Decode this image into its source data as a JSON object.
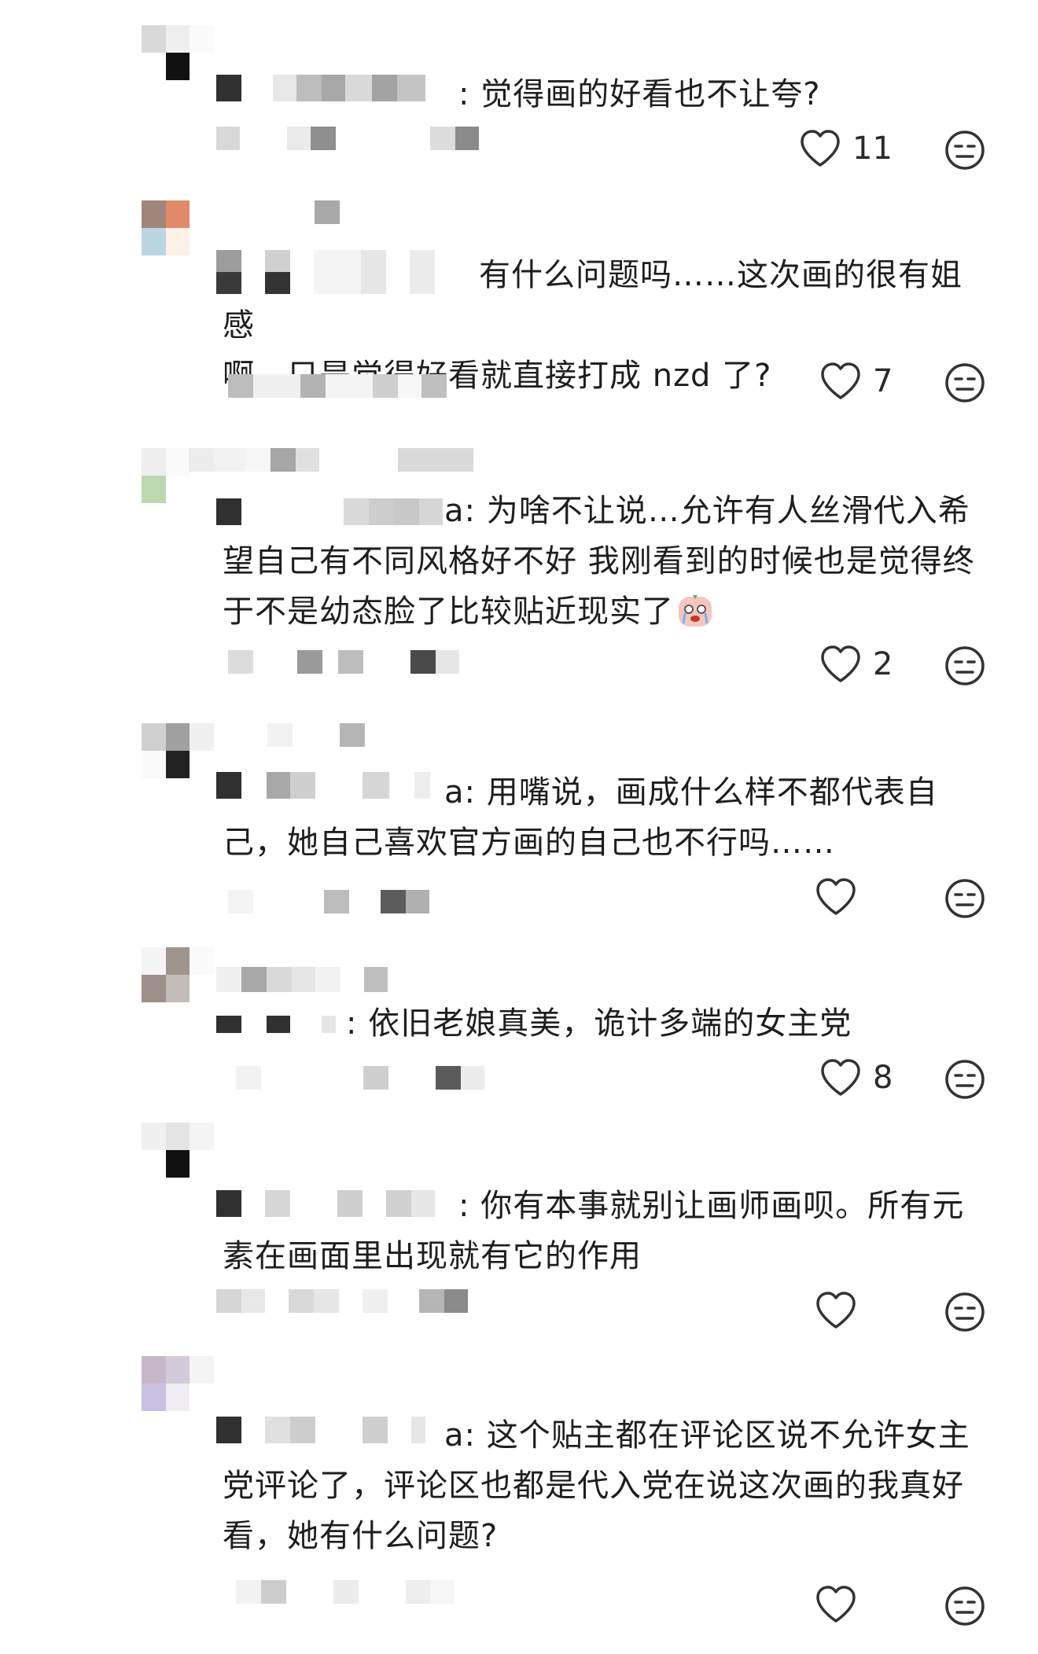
{
  "comments": [
    {
      "text": ": 觉得画的好看也不让夸?",
      "likes": "11"
    },
    {
      "text": "有什么问题吗……这次画的很有姐感\n啊，只是觉得好看就直接打成 nzd 了?",
      "likes": "7"
    },
    {
      "text": "a: 为啥不让说…允许有人丝滑代入希\n望自己有不同风格好不好 我刚看到的时候也是觉得终\n于不是幼态脸了比较贴近现实了",
      "likes": "2",
      "sticker": "crying-face-sticker"
    },
    {
      "text": "a: 用嘴说，画成什么样不都代表自\n己，她自己喜欢官方画的自己也不行吗……",
      "likes": ""
    },
    {
      "text": ": 依旧老娘真美，诡计多端的女主党",
      "likes": "8"
    },
    {
      "text": ": 你有本事就别让画师画呗。所有元\n素在画面里出现就有它的作用",
      "likes": ""
    },
    {
      "text": "a: 这个贴主都在评论区说不允许女主\n党评论了，评论区也都是代入党在说这次画的我真好\n看，她有什么问题?",
      "likes": ""
    }
  ],
  "icons": {
    "like": "heart-outline-icon",
    "dislike": "neutral-face-icon"
  },
  "colors": {
    "text": "#1e1e1e",
    "icon": "#333333",
    "mosaic_dark": "#3a3a3a",
    "mosaic_mid": "#9a9a9a",
    "mosaic_light": "#e6e6e6"
  }
}
